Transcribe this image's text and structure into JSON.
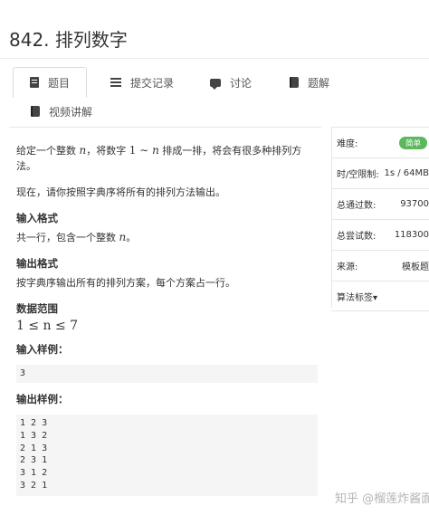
{
  "problem": {
    "title": "842. 排列数字"
  },
  "tabs": [
    {
      "label": "题目",
      "icon": "document-icon",
      "active": true
    },
    {
      "label": "提交记录",
      "icon": "list-icon"
    },
    {
      "label": "讨论",
      "icon": "chat-icon"
    },
    {
      "label": "题解",
      "icon": "book-icon"
    },
    {
      "label": "视频讲解",
      "icon": "book-icon"
    }
  ],
  "statement": {
    "intro_a": "给定一个整数 ",
    "n": "n",
    "intro_b": "，将数字 ",
    "one": "1",
    "tilde": " ∼ ",
    "intro_c": " 排成一排，将会有很多种排列方法。",
    "intro2": "现在，请你按照字典序将所有的排列方法输出。",
    "input_format_title": "输入格式",
    "input_format_a": "共一行，包含一个整数 ",
    "input_format_b": "。",
    "output_format_title": "输出格式",
    "output_format": "按字典序输出所有的排列方案，每个方案占一行。",
    "range_title": "数据范围",
    "range_expr": "1 ≤ n ≤ 7",
    "sample_input_title": "输入样例：",
    "sample_input": "3",
    "sample_output_title": "输出样例：",
    "sample_output_lines": [
      "1 2 3",
      "1 3 2",
      "2 1 3",
      "2 3 1",
      "3 1 2",
      "3 2 1"
    ]
  },
  "sidebar": {
    "difficulty_label": "难度:",
    "difficulty_value": "简单",
    "limits_label": "时/空限制:",
    "limits_value": "1s / 64MB",
    "passed_label": "总通过数:",
    "passed_value": "93700",
    "attempts_label": "总尝试数:",
    "attempts_value": "118300",
    "source_label": "来源:",
    "source_value": "模板题",
    "tags_label": "算法标签▾"
  },
  "watermark": {
    "text": "知乎 @榴莲炸酱面"
  },
  "colors": {
    "badge_green": "#5cb85c",
    "sample_bg": "#f5f5f5"
  }
}
